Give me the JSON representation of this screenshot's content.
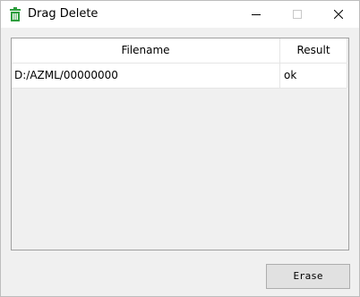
{
  "window": {
    "title": "Drag Delete",
    "app_icon": "trash-bin-icon",
    "controls": [
      "minimize-icon",
      "maximize-icon",
      "close-icon"
    ]
  },
  "table": {
    "columns": [
      "Filename",
      "Result"
    ],
    "rows": [
      {
        "filename": "D:/AZML/00000000",
        "result": "ok"
      }
    ]
  },
  "buttons": {
    "erase_label": "Erase"
  },
  "colors": {
    "icon_green": "#2e9e3e",
    "window_bg": "#f0f0f0",
    "table_bg": "#ffffff"
  }
}
